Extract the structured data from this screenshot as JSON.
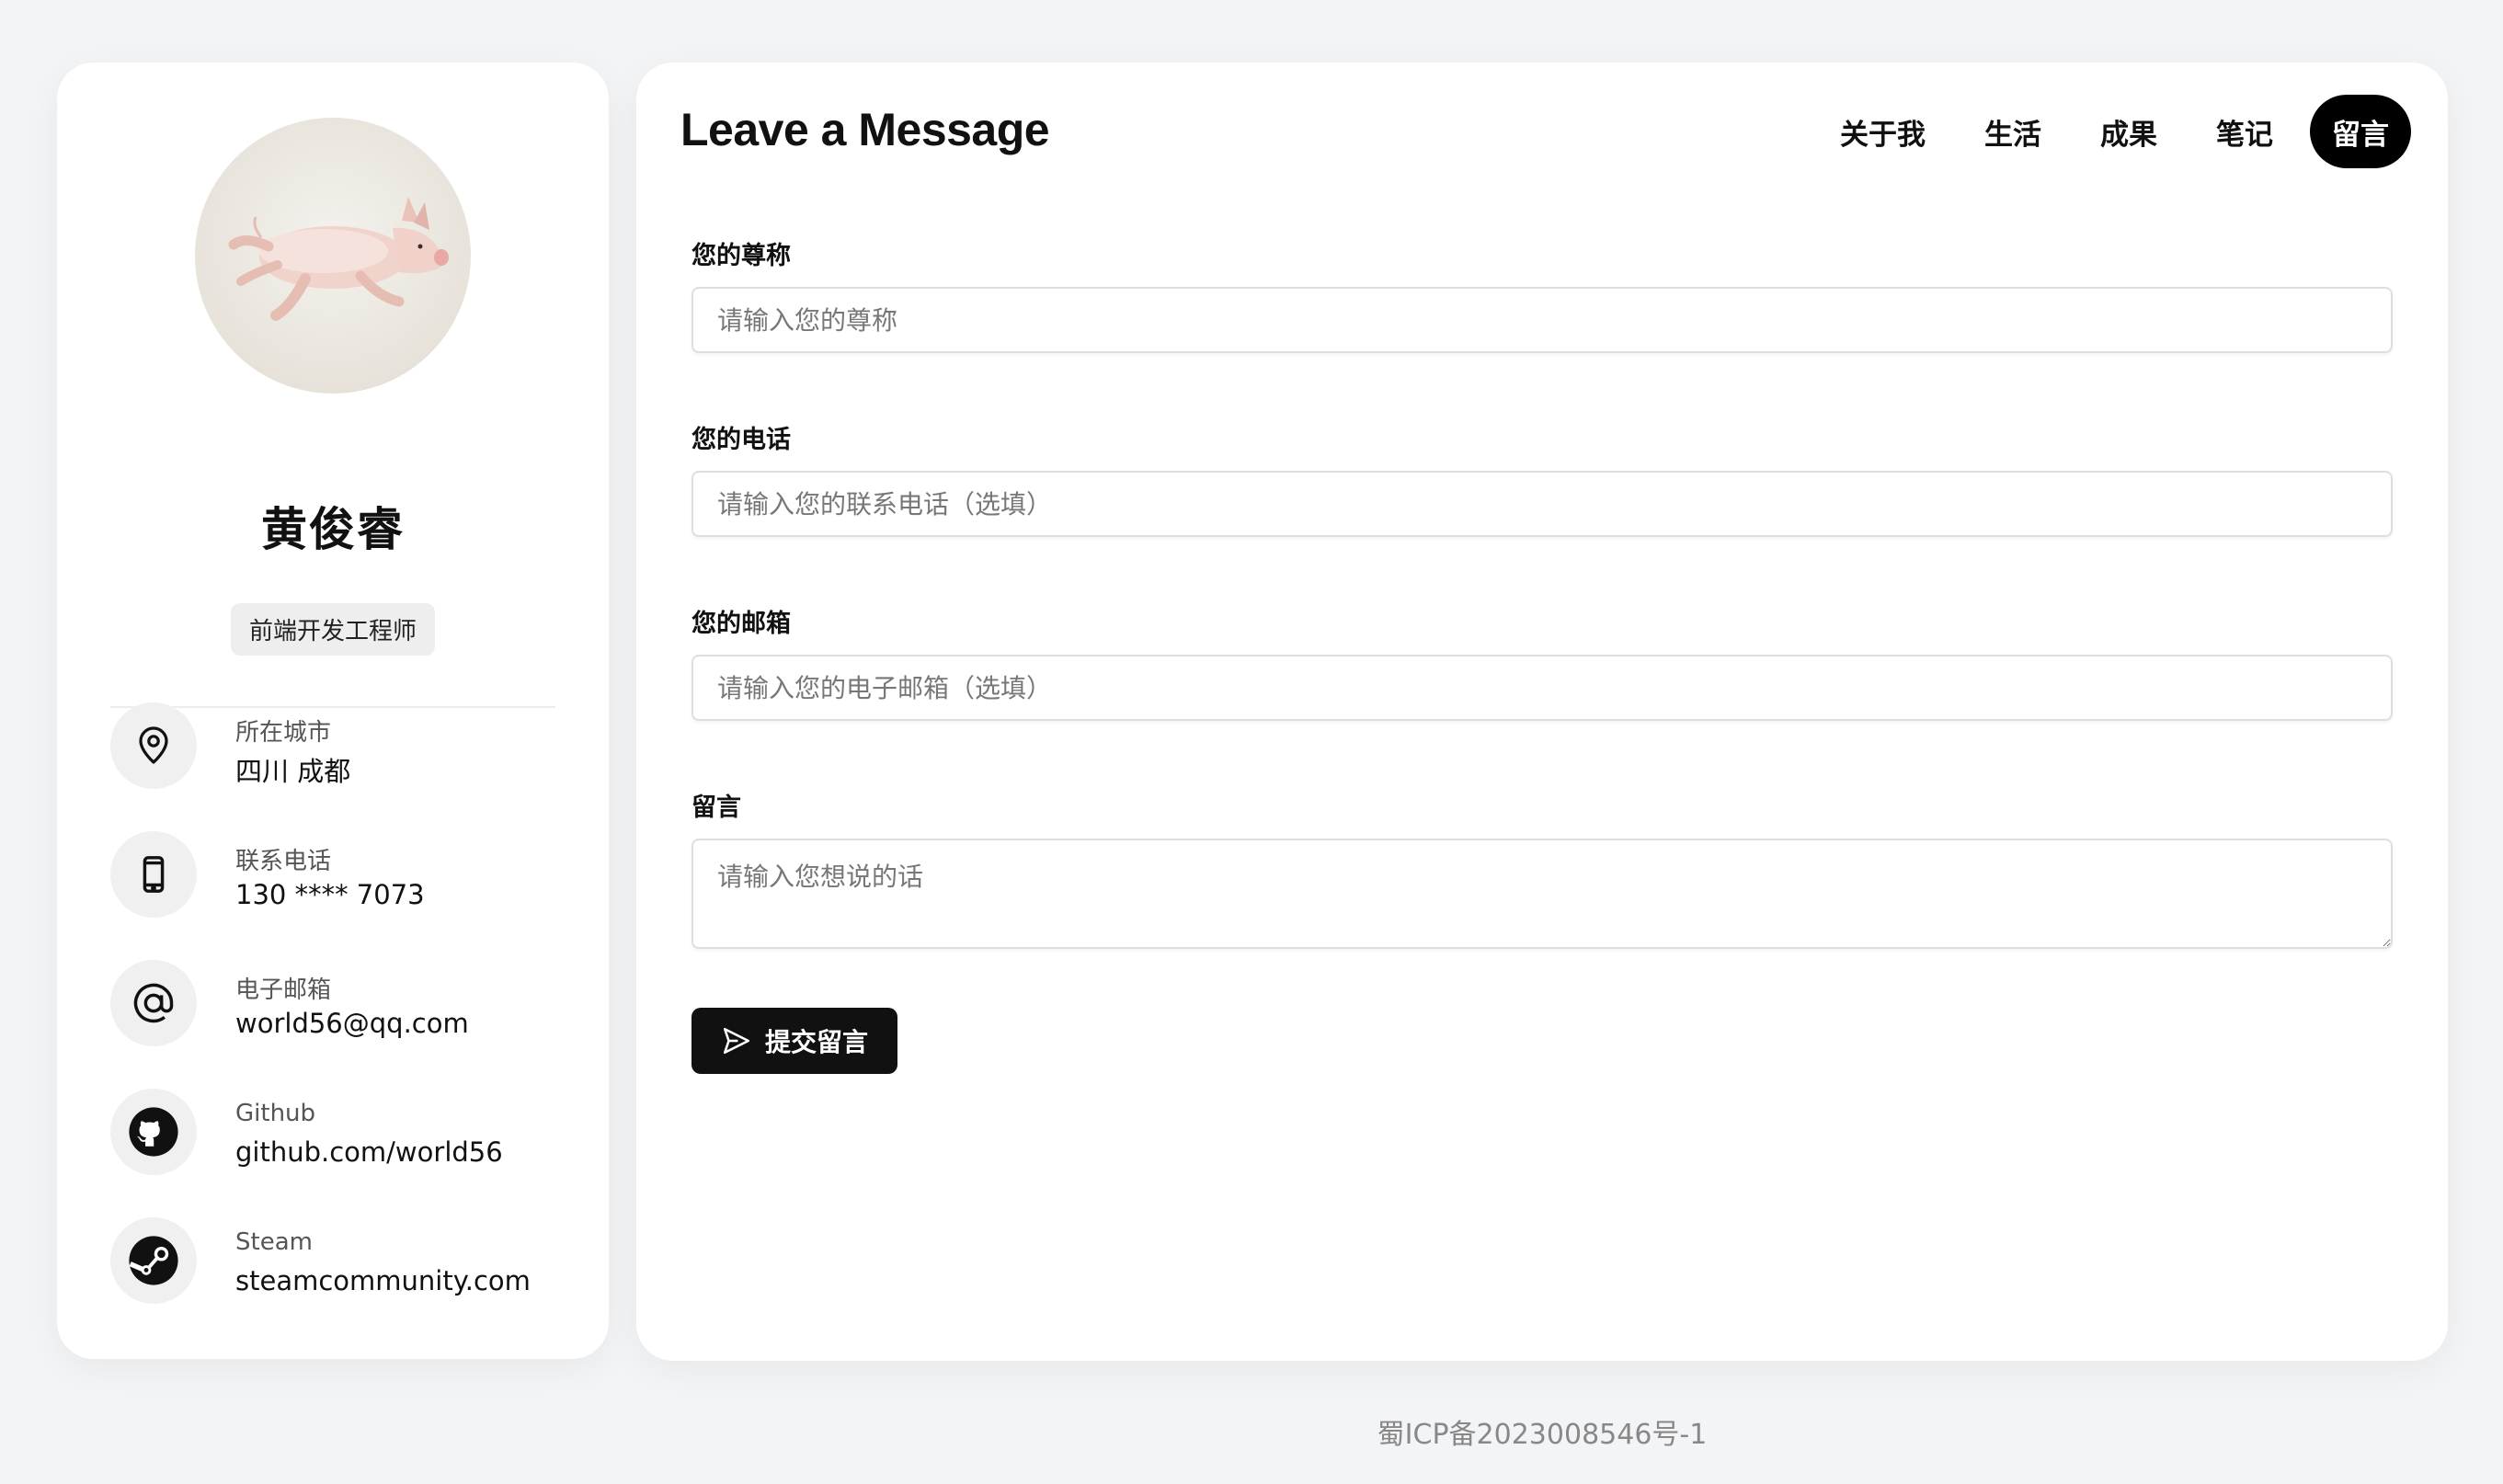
{
  "profile": {
    "name": "黄俊睿",
    "title": "前端开发工程师",
    "avatar_icon": "pig-photo"
  },
  "contacts": [
    {
      "icon": "location-pin-icon",
      "label": "所在城市",
      "value": "四川 成都"
    },
    {
      "icon": "phone-icon",
      "label": "联系电话",
      "value": "130 **** 7073"
    },
    {
      "icon": "at-sign-icon",
      "label": "电子邮箱",
      "value": "world56@qq.com"
    },
    {
      "icon": "github-icon",
      "label": "Github",
      "value": "github.com/world56"
    },
    {
      "icon": "steam-icon",
      "label": "Steam",
      "value": "steamcommunity.com"
    }
  ],
  "main": {
    "title": "Leave a Message",
    "nav": [
      "关于我",
      "生活",
      "成果",
      "笔记",
      "留言"
    ],
    "active_nav": "留言"
  },
  "form": {
    "name_label": "您的尊称",
    "name_placeholder": "请输入您的尊称",
    "phone_label": "您的电话",
    "phone_placeholder": "请输入您的联系电话（选填）",
    "email_label": "您的邮箱",
    "email_placeholder": "请输入您的电子邮箱（选填）",
    "message_label": "留言",
    "message_placeholder": "请输入您想说的话",
    "submit_label": "提交留言"
  },
  "footer": {
    "icp": "蜀ICP备2023008546号-1"
  },
  "colors": {
    "accent": "#000000",
    "background": "#f3f4f6",
    "card": "#ffffff"
  }
}
